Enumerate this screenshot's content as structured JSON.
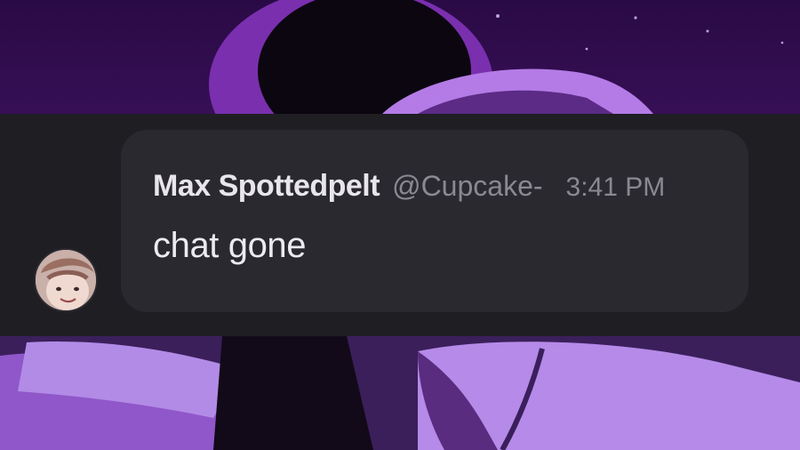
{
  "message": {
    "username": "Max Spottedpelt",
    "handle": "@Cupcake-",
    "timestamp": "3:41 PM",
    "text": "chat gone",
    "avatar_icon": "user-avatar"
  },
  "colors": {
    "band_bg": "#1f1e23",
    "bubble_bg": "#2a2930",
    "username": "#e8e6ea",
    "muted": "#8a8890",
    "message": "#ecebef",
    "background_purple": "#3a0f5a"
  }
}
